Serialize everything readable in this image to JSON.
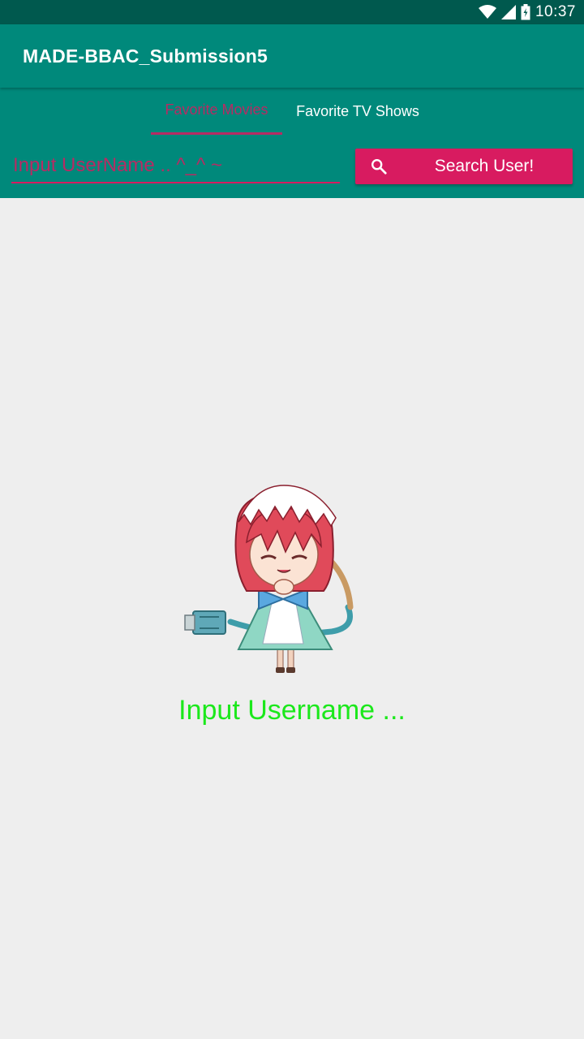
{
  "status_bar": {
    "time": "10:37",
    "icons": [
      "wifi-icon",
      "signal-icon",
      "battery-icon"
    ]
  },
  "app_bar": {
    "title": "MADE-BBAC_Submission5"
  },
  "tabs": [
    {
      "label": "Favorite Movies",
      "selected": true
    },
    {
      "label": "Favorite TV Shows",
      "selected": false
    }
  ],
  "search": {
    "placeholder": "Input UserName .. ^_^ ~",
    "value": "",
    "button_label": "Search User!",
    "button_icon": "search-icon"
  },
  "empty_state": {
    "image": "maid-character-illustration",
    "message": "Input Username ..."
  },
  "colors": {
    "primary": "#00897B",
    "primary_dark": "#00594E",
    "accent": "#D81B60",
    "background": "#EEEEEE",
    "message": "#1BE81B"
  }
}
